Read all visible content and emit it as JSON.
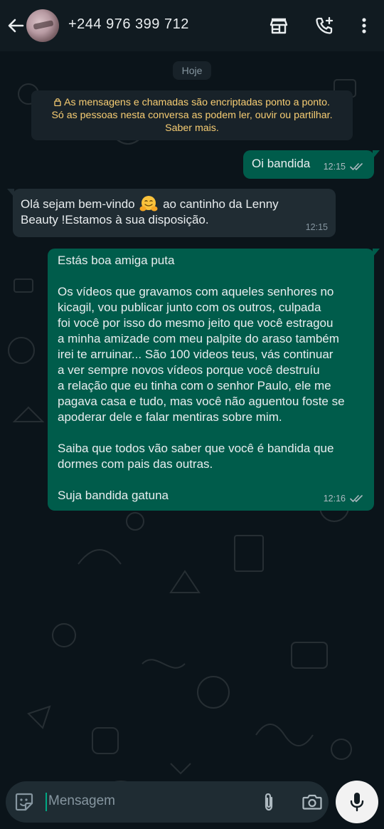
{
  "header": {
    "contact_name": "+244 976 399 712",
    "icons": [
      "back-arrow-icon",
      "shop-icon",
      "add-call-icon",
      "more-vert-icon"
    ]
  },
  "chat": {
    "date_label": "Hoje",
    "encryption_notice": {
      "line1": "As mensagens e chamadas são encriptadas ponto a ponto.",
      "line2": "Só as pessoas nesta conversa as podem ler, ouvir ou partilhar.",
      "link": "Saber mais."
    },
    "messages": [
      {
        "direction": "outgoing",
        "text": "Oi bandida",
        "time": "12:15",
        "status": "read"
      },
      {
        "direction": "incoming",
        "text_before_emoji": "Olá sejam bem-vindo",
        "emoji": "hugging-face-emoji",
        "text_after_emoji": "ao cantinho da Lenny",
        "text_line2": "Beauty !Estamos à sua disposição.",
        "time": "12:15"
      },
      {
        "direction": "outgoing",
        "paragraphs": [
          "Estás boa amiga puta",
          "Os vídeos que gravamos com aqueles senhores no\nkicagil, vou publicar junto com os outros, culpada\nfoi você por isso do mesmo jeito que você estragou\na minha amizade com meu palpite do araso também\nirei te arruinar... São 100 videos teus, vás continuar\na ver sempre novos vídeos porque você destruíu\na relação que eu tinha com o senhor Paulo, ele me\npagava casa e tudo, mas você não aguentou foste se\napoderar dele e falar mentiras sobre mim.",
          " Saiba que todos vão saber que você é bandida que\ndormes com pais das outras.",
          "Suja bandida gatuna"
        ],
        "time": "12:16",
        "status": "read"
      }
    ]
  },
  "composer": {
    "placeholder": "Mensagem",
    "icons": [
      "emoji-sticker-icon",
      "attach-icon",
      "camera-icon",
      "mic-icon"
    ]
  },
  "colors": {
    "background": "#0b141a",
    "header": "#111b21",
    "outgoing_bubble": "#005c4b",
    "incoming_bubble": "#202c33",
    "notice_text": "#f7cd73",
    "accent": "#00a884"
  }
}
